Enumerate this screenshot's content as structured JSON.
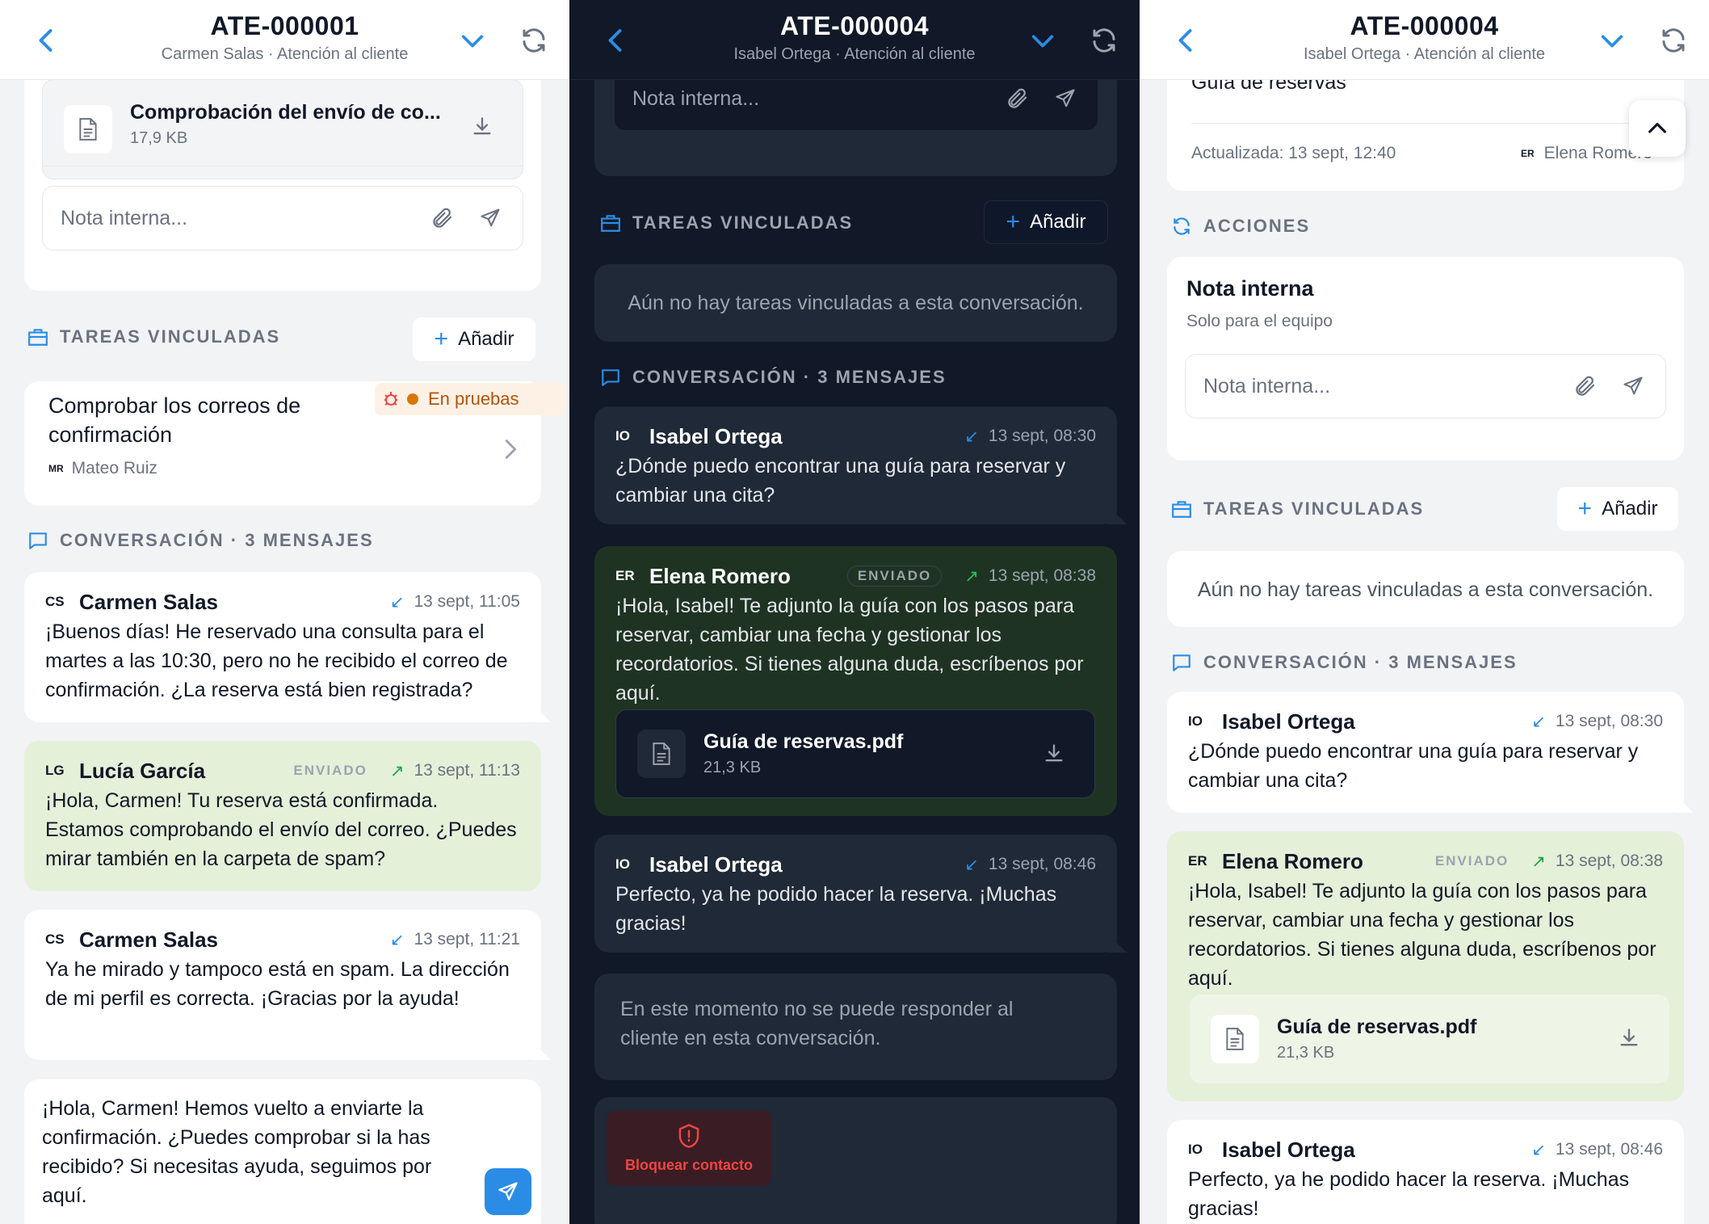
{
  "colors": {
    "accent": "#2b8ce6",
    "sent_bg": "#e4f0d8",
    "dark_bg": "#111827",
    "warn": "#d97706",
    "danger": "#ef4444"
  },
  "p1": {
    "title": "ATE-000001",
    "subtitle": "Carmen Salas · Atención al cliente",
    "top_file": {
      "name": "Comprobación del envío de co...",
      "size": "17,9 KB"
    },
    "note_placeholder": "Nota interna...",
    "tasks_label": "TAREAS VINCULADAS",
    "add": "Añadir",
    "task": {
      "title": "Comprobar los correos de confirmación",
      "status": "En pruebas",
      "assignee_initials": "MR",
      "assignee": "Mateo Ruiz"
    },
    "conv_label": "CONVERSACIÓN · 3 MENSAJES",
    "messages": [
      {
        "initials": "CS",
        "author": "Carmen Salas",
        "time": "13 sept, 11:05",
        "body": "¡Buenos días! He reservado una consulta para el martes a las 10:30, pero no he recibido el correo de confirmación. ¿La reserva está bien registrada?"
      },
      {
        "initials": "LG",
        "author": "Lucía García",
        "sent": "ENVIADO",
        "time": "13 sept, 11:13",
        "body": "¡Hola, Carmen! Tu reserva está confirmada. Estamos comprobando el envío del correo. ¿Puedes mirar también en la carpeta de spam?"
      },
      {
        "initials": "CS",
        "author": "Carmen Salas",
        "time": "13 sept, 11:21",
        "body": "Ya he mirado y tampoco está en spam. La dirección de mi perfil es correcta. ¡Gracias por la ayuda!"
      }
    ],
    "reply": "¡Hola, Carmen! Hemos vuelto a enviarte la confirmación. ¿Puedes comprobar si la has recibido? Si necesitas ayuda, seguimos por aquí."
  },
  "p2": {
    "title": "ATE-000004",
    "subtitle": "Isabel Ortega · Atención al cliente",
    "note_placeholder": "Nota interna...",
    "tasks_label": "TAREAS VINCULADAS",
    "add": "Añadir",
    "no_tasks": "Aún no hay tareas vinculadas a esta conversación.",
    "conv_label": "CONVERSACIÓN · 3 MENSAJES",
    "messages": [
      {
        "initials": "IO",
        "author": "Isabel Ortega",
        "time": "13 sept, 08:30",
        "body": "¿Dónde puedo encontrar una guía para reservar y cambiar una cita?"
      },
      {
        "initials": "ER",
        "author": "Elena Romero",
        "sent": "ENVIADO",
        "time": "13 sept, 08:38",
        "body": "¡Hola, Isabel! Te adjunto la guía con los pasos para reservar, cambiar una fecha y gestionar los recordatorios. Si tienes alguna duda, escríbenos por aquí."
      },
      {
        "initials": "IO",
        "author": "Isabel Ortega",
        "time": "13 sept, 08:46",
        "body": "Perfecto, ya he podido hacer la reserva. ¡Muchas gracias!"
      }
    ],
    "file": {
      "name": "Guía de reservas.pdf",
      "size": "21,3 KB"
    },
    "cannot_reply": "En este momento no se puede responder al cliente en esta conversación.",
    "block": "Bloquear contacto"
  },
  "p3": {
    "title": "ATE-000004",
    "subtitle": "Isabel Ortega · Atención al cliente",
    "doc_title": "Guía de reservas",
    "updated": "Actualizada: 13 sept, 12:40",
    "updater_initials": "ER",
    "updater": "Elena Romero",
    "actions_label": "ACCIONES",
    "note_title": "Nota interna",
    "note_sub": "Solo para el equipo",
    "note_placeholder": "Nota interna...",
    "tasks_label": "TAREAS VINCULADAS",
    "add": "Añadir",
    "no_tasks": "Aún no hay tareas vinculadas a esta conversación.",
    "conv_label": "CONVERSACIÓN · 3 MENSAJES",
    "messages": [
      {
        "initials": "IO",
        "author": "Isabel Ortega",
        "time": "13 sept, 08:30",
        "body": "¿Dónde puedo encontrar una guía para reservar y cambiar una cita?"
      },
      {
        "initials": "ER",
        "author": "Elena Romero",
        "sent": "ENVIADO",
        "time": "13 sept, 08:38",
        "body": "¡Hola, Isabel! Te adjunto la guía con los pasos para reservar, cambiar una fecha y gestionar los recordatorios. Si tienes alguna duda, escríbenos por aquí."
      },
      {
        "initials": "IO",
        "author": "Isabel Ortega",
        "time": "13 sept, 08:46",
        "body": "Perfecto, ya he podido hacer la reserva. ¡Muchas gracias!"
      }
    ],
    "file": {
      "name": "Guía de reservas.pdf",
      "size": "21,3 KB"
    }
  }
}
